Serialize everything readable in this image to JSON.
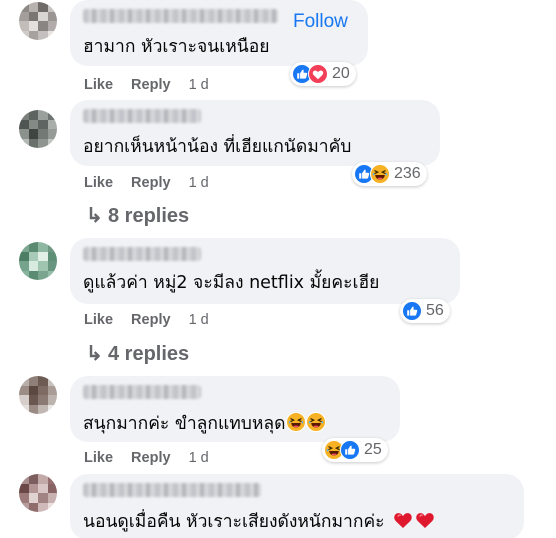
{
  "comments": [
    {
      "text": "ฮามาก หัวเราะจนเหนือย",
      "follow_label": "Follow",
      "like": "Like",
      "reply": "Reply",
      "time": "1 d",
      "reaction_icons": [
        "like-icon",
        "love-icon"
      ],
      "reaction_count": "20"
    },
    {
      "text": "อยากเห็นหน้าน้อง ที่เฮียแกนัดมาคับ",
      "like": "Like",
      "reply": "Reply",
      "time": "1 d",
      "reaction_icons": [
        "like-icon",
        "haha-icon"
      ],
      "reaction_count": "236",
      "replies_label": "8 replies"
    },
    {
      "text": "ดูแล้วค่า หมู่2 จะมีลง netflix มั้ยคะเฮีย",
      "like": "Like",
      "reply": "Reply",
      "time": "1 d",
      "reaction_icons": [
        "like-icon"
      ],
      "reaction_count": "56",
      "replies_label": "4 replies"
    },
    {
      "text": "สนุกมากค่ะ ขำลูกแทบหลุด",
      "like": "Like",
      "reply": "Reply",
      "time": "1 d",
      "reaction_icons": [
        "haha-icon",
        "like-icon"
      ],
      "reaction_count": "25"
    },
    {
      "text": "นอนดูเมื่อคืน หัวเราะเสียงดังหนักมากค่ะ"
    }
  ],
  "colors": {
    "bubble": "#f0f2f5",
    "meta": "#65676b",
    "link_blue": "#1877f2",
    "like_blue": "#1877f2",
    "love_red": "#f33e58",
    "haha_yellow": "#f7b125"
  }
}
